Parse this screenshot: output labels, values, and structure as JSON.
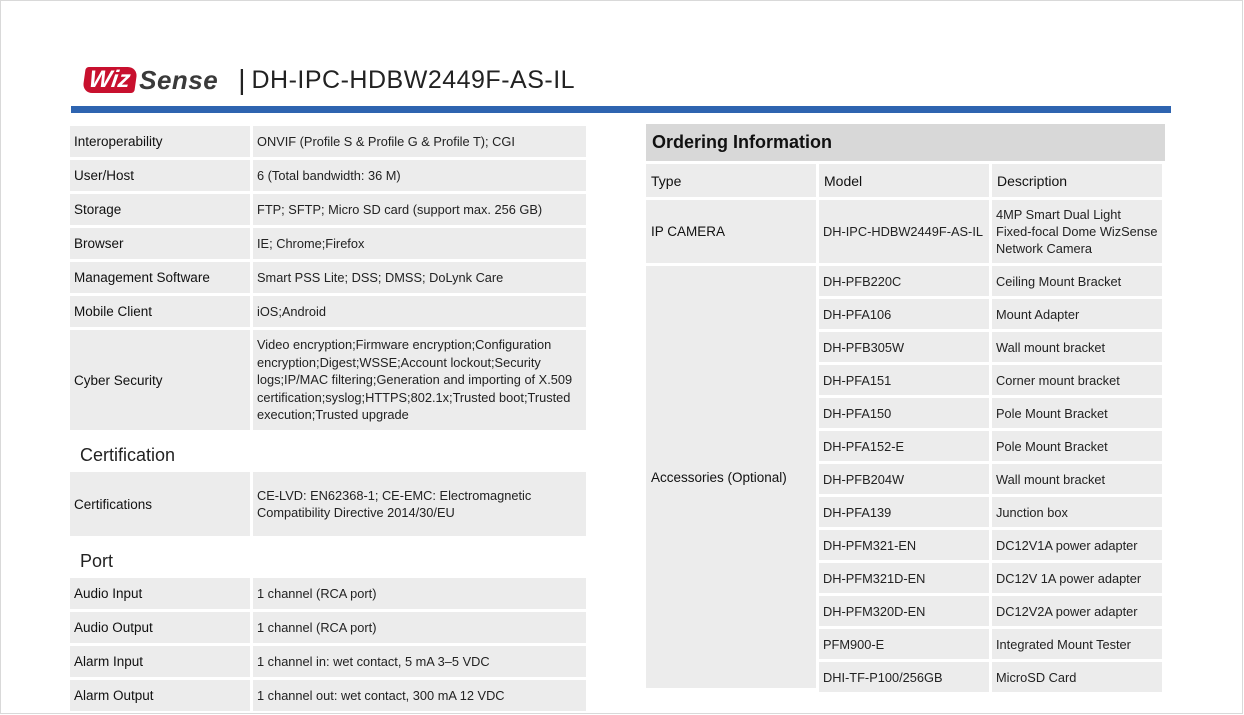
{
  "brand": {
    "logo_red": "Wiz",
    "logo_gray": "Sense",
    "separator": "|",
    "model": "DH-IPC-HDBW2449F-AS-IL"
  },
  "colors": {
    "brand_red": "#c8102e",
    "accent_blue": "#2e64b0",
    "cell_gray": "#ececec",
    "title_gray": "#d8d8d8"
  },
  "specs_top": [
    {
      "key": "Interoperability",
      "value": "ONVIF (Profile S & Profile G & Profile T); CGI"
    },
    {
      "key": "User/Host",
      "value": "6 (Total bandwidth: 36 M)"
    },
    {
      "key": "Storage",
      "value": "FTP; SFTP; Micro SD card (support max. 256 GB)"
    },
    {
      "key": "Browser",
      "value": "IE; Chrome;Firefox"
    },
    {
      "key": "Management Software",
      "value": "Smart PSS Lite; DSS; DMSS; DoLynk Care"
    },
    {
      "key": "Mobile Client",
      "value": "iOS;Android"
    },
    {
      "key": "Cyber Security",
      "value": "Video encryption;Firmware encryption;Configuration encryption;Digest;WSSE;Account lockout;Security logs;IP/MAC filtering;Generation and importing of X.509 certification;syslog;HTTPS;802.1x;Trusted boot;Trusted execution;Trusted upgrade"
    }
  ],
  "certification": {
    "title": "Certification",
    "rows": [
      {
        "key": "Certifications",
        "value": "CE-LVD: EN62368-1; CE-EMC: Electromagnetic Compatibility Directive 2014/30/EU"
      }
    ]
  },
  "port": {
    "title": "Port",
    "rows": [
      {
        "key": "Audio Input",
        "value": "1 channel (RCA port)"
      },
      {
        "key": "Audio Output",
        "value": "1 channel (RCA port)"
      },
      {
        "key": "Alarm Input",
        "value": "1 channel in: wet contact, 5 mA 3–5 VDC"
      },
      {
        "key": "Alarm Output",
        "value": "1 channel out: wet contact, 300 mA 12 VDC"
      }
    ]
  },
  "ordering": {
    "title": "Ordering Information",
    "headers": {
      "type": "Type",
      "model": "Model",
      "description": "Description"
    },
    "type_camera": "IP CAMERA",
    "type_accessories": "Accessories (Optional)",
    "rows": [
      {
        "model": "DH-IPC-HDBW2449F-AS-IL",
        "description": "4MP Smart Dual Light Fixed-focal Dome WizSense Network Camera"
      },
      {
        "model": "DH-PFB220C",
        "description": "Ceiling Mount Bracket"
      },
      {
        "model": "DH-PFA106",
        "description": "Mount Adapter"
      },
      {
        "model": "DH-PFB305W",
        "description": "Wall mount bracket"
      },
      {
        "model": "DH-PFA151",
        "description": "Corner mount bracket"
      },
      {
        "model": "DH-PFA150",
        "description": "Pole Mount Bracket"
      },
      {
        "model": "DH-PFA152-E",
        "description": "Pole Mount Bracket"
      },
      {
        "model": "DH-PFB204W",
        "description": "Wall mount bracket"
      },
      {
        "model": "DH-PFA139",
        "description": "Junction box"
      },
      {
        "model": "DH-PFM321-EN",
        "description": "DC12V1A power adapter"
      },
      {
        "model": "DH-PFM321D-EN",
        "description": "DC12V 1A power adapter"
      },
      {
        "model": "DH-PFM320D-EN",
        "description": "DC12V2A power adapter"
      },
      {
        "model": "PFM900-E",
        "description": "Integrated Mount Tester"
      },
      {
        "model": "DHI-TF-P100/256GB",
        "description": "MicroSD Card"
      }
    ]
  }
}
